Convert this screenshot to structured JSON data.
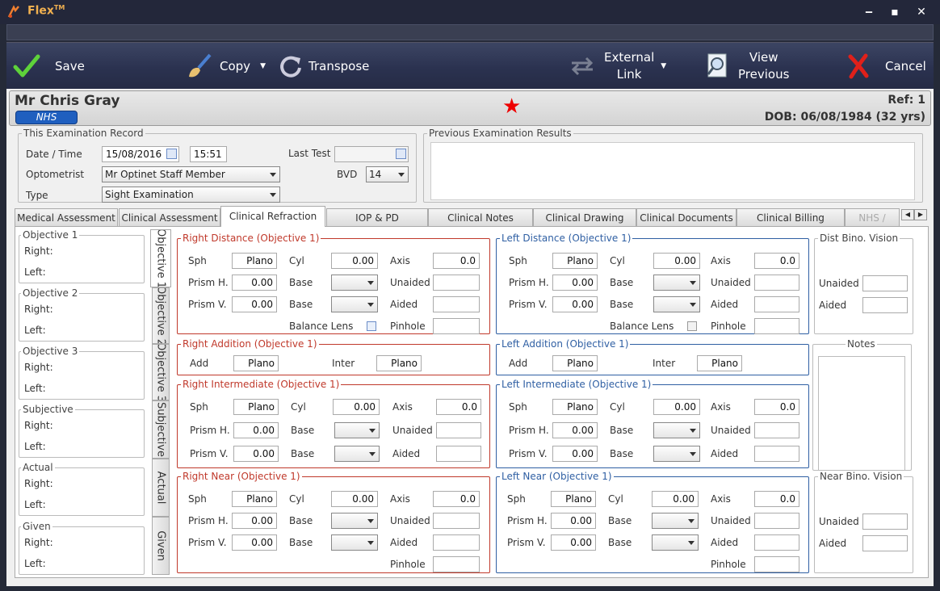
{
  "app": {
    "title": "Flex",
    "tm": "TM"
  },
  "toolbar": {
    "save": "Save",
    "copy": "Copy",
    "transpose": "Transpose",
    "external_link_1": "External",
    "external_link_2": "Link",
    "view_previous_1": "View",
    "view_previous_2": "Previous",
    "cancel": "Cancel"
  },
  "patient": {
    "name": "Mr Chris Gray",
    "badge": "NHS",
    "ref": "Ref: 1",
    "dob": "DOB: 06/08/1984 (32 yrs)"
  },
  "exam": {
    "legend": "This Examination Record",
    "date_label": "Date / Time",
    "date": "15/08/2016",
    "time": "15:51",
    "last_test_label": "Last Test",
    "last_test": "",
    "optometrist_label": "Optometrist",
    "optometrist": "Mr Optinet Staff Member",
    "bvd_label": "BVD",
    "bvd": "14",
    "type_label": "Type",
    "type": "Sight Examination"
  },
  "previous": {
    "legend": "Previous Examination Results"
  },
  "tabs": [
    "Medical Assessment",
    "Clinical Assessment",
    "Clinical Refraction",
    "IOP & PD",
    "Clinical Notes",
    "Clinical Drawing",
    "Clinical Documents",
    "Clinical Billing",
    "NHS /"
  ],
  "vtabs": [
    "Objective 1",
    "Objective 2",
    "Objective 3",
    "Subjective",
    "Actual",
    "Given"
  ],
  "summary": [
    {
      "title": "Objective 1",
      "right": "Right:",
      "left": "Left:"
    },
    {
      "title": "Objective 2",
      "right": "Right:",
      "left": "Left:"
    },
    {
      "title": "Objective 3",
      "right": "Right:",
      "left": "Left:"
    },
    {
      "title": "Subjective",
      "right": "Right:",
      "left": "Left:"
    },
    {
      "title": "Actual",
      "right": "Right:",
      "left": "Left:"
    },
    {
      "title": "Given",
      "right": "Right:",
      "left": "Left:"
    }
  ],
  "labels": {
    "sph": "Sph",
    "cyl": "Cyl",
    "axis": "Axis",
    "prism_h": "Prism H.",
    "prism_v": "Prism V.",
    "base": "Base",
    "unaided": "Unaided",
    "aided": "Aided",
    "pinhole": "Pinhole",
    "balance": "Balance Lens",
    "add": "Add",
    "inter": "Inter"
  },
  "right_distance": {
    "legend": "Right Distance (Objective 1)",
    "sph": "Plano",
    "cyl": "0.00",
    "axis": "0.0",
    "prism_h": "0.00",
    "prism_v": "0.00"
  },
  "left_distance": {
    "legend": "Left Distance (Objective 1)",
    "sph": "Plano",
    "cyl": "0.00",
    "axis": "0.0",
    "prism_h": "0.00",
    "prism_v": "0.00"
  },
  "right_addition": {
    "legend": "Right Addition (Objective 1)",
    "add": "Plano",
    "inter": "Plano"
  },
  "left_addition": {
    "legend": "Left Addition (Objective 1)",
    "add": "Plano",
    "inter": "Plano"
  },
  "right_intermediate": {
    "legend": "Right Intermediate (Objective 1)",
    "sph": "Plano",
    "cyl": "0.00",
    "axis": "0.0",
    "prism_h": "0.00",
    "prism_v": "0.00"
  },
  "left_intermediate": {
    "legend": "Left Intermediate (Objective 1)",
    "sph": "Plano",
    "cyl": "0.00",
    "axis": "0.0",
    "prism_h": "0.00",
    "prism_v": "0.00"
  },
  "right_near": {
    "legend": "Right Near (Objective 1)",
    "sph": "Plano",
    "cyl": "0.00",
    "axis": "0.0",
    "prism_h": "0.00",
    "prism_v": "0.00"
  },
  "left_near": {
    "legend": "Left Near (Objective 1)",
    "sph": "Plano",
    "cyl": "0.00",
    "axis": "0.0",
    "prism_h": "0.00",
    "prism_v": "0.00"
  },
  "dist_bino": {
    "legend": "Dist Bino. Vision",
    "unaided": "Unaided",
    "aided": "Aided"
  },
  "notes": {
    "legend": "Notes"
  },
  "near_bino": {
    "legend": "Near Bino. Vision",
    "unaided": "Unaided",
    "aided": "Aided"
  },
  "colors": {
    "right": "#c0392b",
    "left": "#2f5fa3",
    "toolbar": "#2b3250",
    "badge": "#1f5fbf"
  }
}
